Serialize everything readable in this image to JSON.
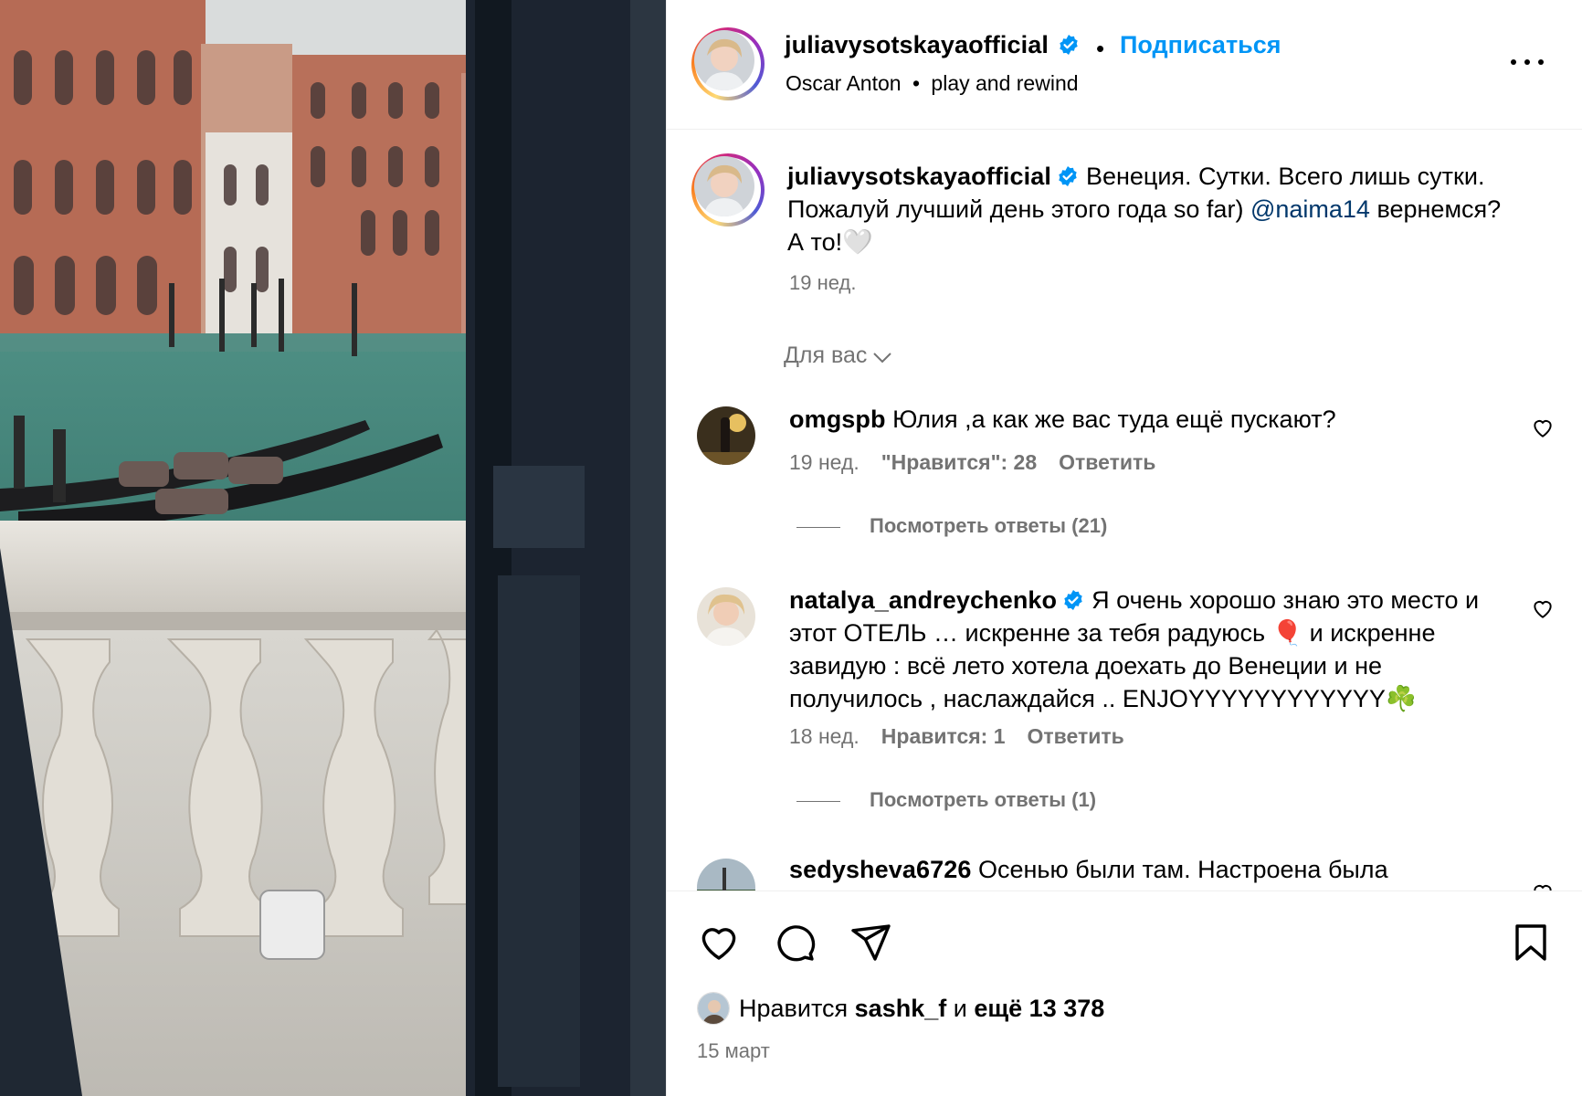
{
  "post": {
    "username": "juliavysotskayaofficial",
    "follow_label": "Подписаться",
    "separator": "•",
    "audio_artist": "Oscar Anton",
    "audio_track": "play and rewind",
    "audio_sep": "•"
  },
  "caption": {
    "username": "juliavysotskayaofficial",
    "text_before": "Венеция. Сутки. Всего лишь сутки. Пожалуй лучший день этого года so far)",
    "mention": "@naima14",
    "text_after": "вернемся? А то!🤍",
    "time": "19 нед."
  },
  "filter_label": "Для вас",
  "comments": [
    {
      "username": "omgspb",
      "text": "Юлия ,а как же вас туда ещё пускают?",
      "time": "19 нед.",
      "likes": "\"Нравится\": 28",
      "reply_label": "Ответить",
      "view_replies": "Посмотреть ответы (21)"
    },
    {
      "username": "natalya_andreychenko",
      "text": "Я очень хорошо знаю это место и этот ОТЕЛЬ … искренне за тебя радуюсь 🎈 и искренне завидую : всё лето хотела доехать до Венеции и не получилось , наслаждайся .. ENJOYYYYYYYYYYYY☘️",
      "time": "18 нед.",
      "likes": "Нравится: 1",
      "reply_label": "Ответить",
      "view_replies": "Посмотреть ответы (1)"
    },
    {
      "username": "sedysheva6726",
      "text": "Осенью были там. Настроена была"
    }
  ],
  "likes_summary": {
    "prefix": "Нравится",
    "user": "sashk_f",
    "conj": "и",
    "rest": "ещё 13 378"
  },
  "post_date": "15 март",
  "icons": {
    "like": "heart-icon",
    "comment": "comment-icon",
    "share": "paper-plane-icon",
    "save": "bookmark-icon",
    "more": "more-icon",
    "verified": "verified-badge-icon"
  },
  "colors": {
    "link": "#0095f6",
    "secondary_text": "#737373",
    "verified": "#0095f6",
    "mention": "#00376b"
  }
}
